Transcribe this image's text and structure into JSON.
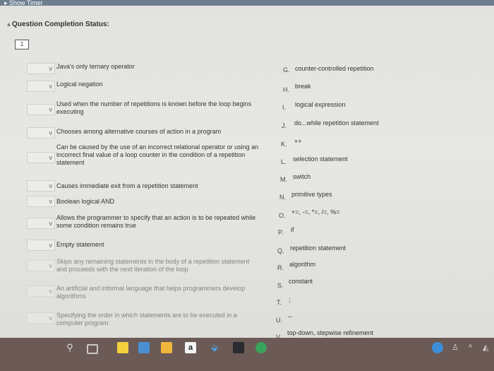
{
  "header": {
    "show_timer": "Show Timer",
    "section_title": "Question Completion Status:",
    "question_number": "1"
  },
  "prompts": [
    "Java's only ternary operator",
    "Logical negation",
    "Used when the number of repetitions is known before the loop begins executing",
    "Chooses among alternative courses of action in a program",
    "Can be caused by the use of an incorrect relational operator or using an incorrect final value of a loop counter in the condition of a repetition statement",
    "Causes immediate exit from a repetition statement",
    "Boolean logical AND",
    "Allows the programmer to specify that an action is to be repeated while some condition remains true",
    "Empty statement",
    "Skips any remaining statements in the body of a repetition statement and proceeds with the next iteration of the loop",
    "An artificial and informal language that helps programmers develop algorithms",
    "Specifying the order in which statements are to be executed in a computer program"
  ],
  "answers": [
    {
      "letter": "G.",
      "text": "counter-controlled repetition"
    },
    {
      "letter": "H.",
      "text": "break"
    },
    {
      "letter": "I.",
      "text": "logical expression"
    },
    {
      "letter": "J.",
      "text": "do...while repetition statement"
    },
    {
      "letter": "K.",
      "text": "++"
    },
    {
      "letter": "L.",
      "text": "selection statement"
    },
    {
      "letter": "M.",
      "text": "switch"
    },
    {
      "letter": "N.",
      "text": "primitive types"
    },
    {
      "letter": "O.",
      "text": "+=, -=, *=, /=, %="
    },
    {
      "letter": "P.",
      "text": "if"
    },
    {
      "letter": "Q.",
      "text": "repetition statement"
    },
    {
      "letter": "R.",
      "text": "algorithm"
    },
    {
      "letter": "S.",
      "text": "constant"
    },
    {
      "letter": "T.",
      "text": ";"
    },
    {
      "letter": "U.",
      "text": "--"
    },
    {
      "letter": "V.",
      "text": "top-down, stepwise refinement"
    }
  ],
  "taskbar": {
    "amazon_label": "a"
  }
}
